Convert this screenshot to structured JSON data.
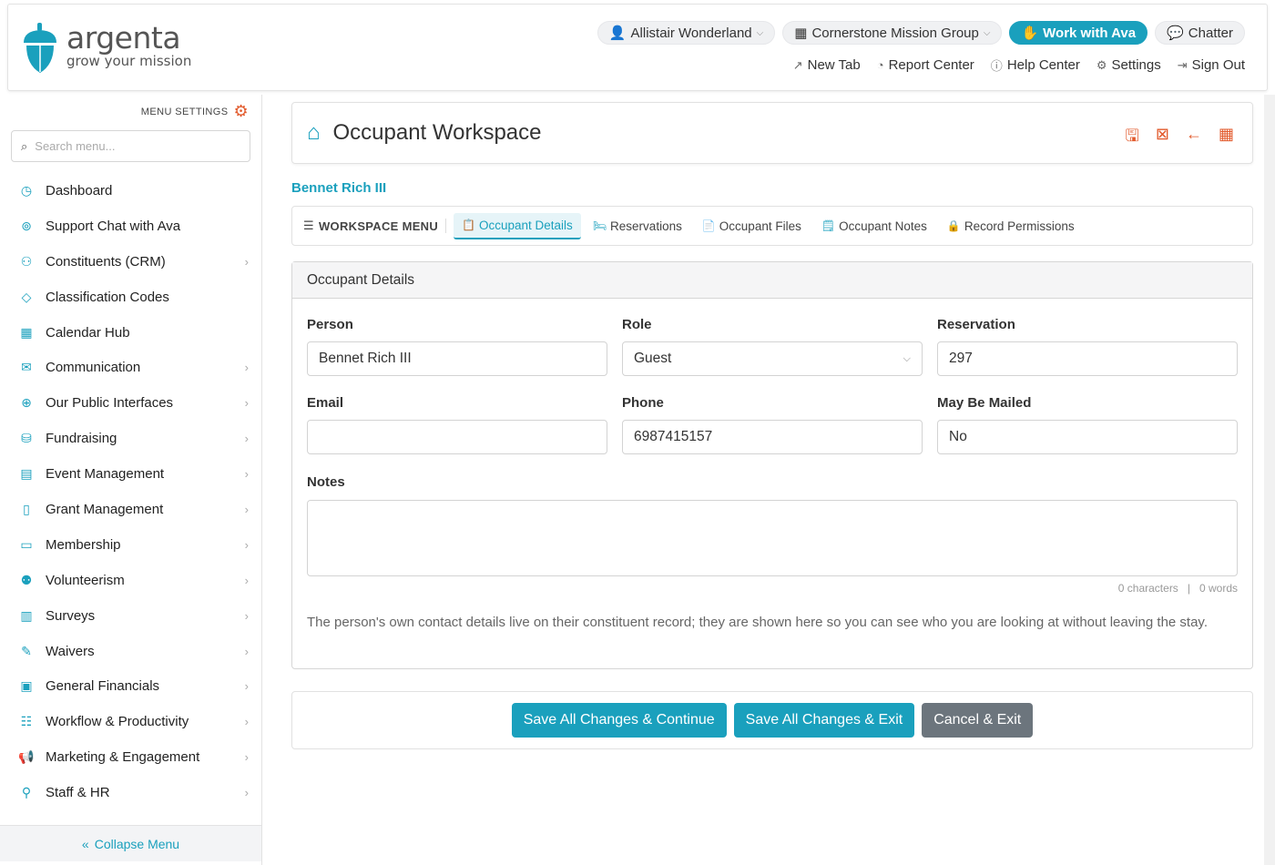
{
  "brand": {
    "name": "argenta",
    "tagline": "grow your mission",
    "accent": "#1aa0bd",
    "action_color": "#e25a2c"
  },
  "header": {
    "user_pill": "Allistair Wonderland",
    "org_pill": "Cornerstone Mission Group",
    "ava_button": "Work with Ava",
    "chatter_button": "Chatter",
    "links": {
      "new_tab": "New Tab",
      "report_center": "Report Center",
      "help_center": "Help Center",
      "settings": "Settings",
      "sign_out": "Sign Out"
    }
  },
  "sidebar": {
    "menu_settings": "MENU SETTINGS",
    "search_placeholder": "Search menu...",
    "items": [
      {
        "label": "Dashboard",
        "icon": "dashboard-icon"
      },
      {
        "label": "Support Chat with Ava",
        "icon": "chat-icon"
      },
      {
        "label": "Constituents (CRM)",
        "icon": "people-icon"
      },
      {
        "label": "Classification Codes",
        "icon": "tag-icon"
      },
      {
        "label": "Calendar Hub",
        "icon": "calendar-icon"
      },
      {
        "label": "Communication",
        "icon": "mail-icon"
      },
      {
        "label": "Our Public Interfaces",
        "icon": "globe-icon"
      },
      {
        "label": "Fundraising",
        "icon": "donate-icon"
      },
      {
        "label": "Event Management",
        "icon": "event-icon"
      },
      {
        "label": "Grant Management",
        "icon": "grant-icon"
      },
      {
        "label": "Membership",
        "icon": "id-card-icon"
      },
      {
        "label": "Volunteerism",
        "icon": "volunteer-icon"
      },
      {
        "label": "Surveys",
        "icon": "survey-icon"
      },
      {
        "label": "Waivers",
        "icon": "waiver-icon"
      },
      {
        "label": "General Financials",
        "icon": "financials-icon"
      },
      {
        "label": "Workflow & Productivity",
        "icon": "workflow-icon"
      },
      {
        "label": "Marketing & Engagement",
        "icon": "megaphone-icon"
      },
      {
        "label": "Staff & HR",
        "icon": "staff-icon"
      }
    ],
    "collapse_label": "Collapse Menu"
  },
  "page": {
    "title": "Occupant Workspace",
    "person_name": "Bennet Rich III",
    "workspace_menu_label": "WORKSPACE MENU",
    "tabs": [
      {
        "label": "Occupant Details"
      },
      {
        "label": "Reservations"
      },
      {
        "label": "Occupant Files"
      },
      {
        "label": "Occupant Notes"
      },
      {
        "label": "Record Permissions"
      }
    ]
  },
  "details": {
    "section_title": "Occupant Details",
    "person_label": "Person",
    "person_value": "Bennet Rich III",
    "role_label": "Role",
    "role_value": "Guest",
    "reservation_label": "Reservation",
    "reservation_value": "297",
    "email_label": "Email",
    "email_value": "",
    "phone_label": "Phone",
    "phone_value": "6987415157",
    "mailed_label": "May Be Mailed",
    "mailed_value": "No",
    "notes_label": "Notes",
    "notes_value": "",
    "char_count": "0 characters",
    "counter_separator": "|",
    "word_count": "0 words",
    "help_text": "The person's own contact details live on their constituent record; they are shown here so you can see who you are looking at without leaving the stay."
  },
  "actions": {
    "save_continue": "Save All Changes & Continue",
    "save_exit": "Save All Changes & Exit",
    "cancel_exit": "Cancel & Exit"
  }
}
